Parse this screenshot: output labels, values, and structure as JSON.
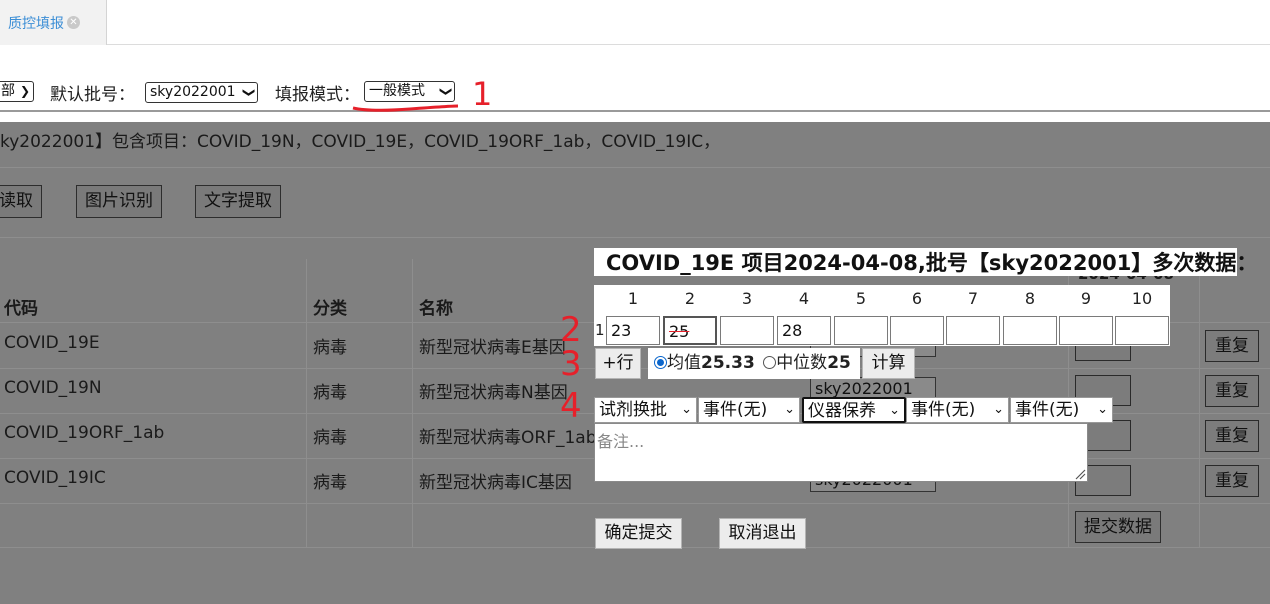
{
  "tabbar": {
    "tab_label": "质控填报",
    "close_glyph": "✕"
  },
  "toprow": {
    "partial_select": "部",
    "batch_label": "默认批号：",
    "batch_value": "sky2022001",
    "mode_label": "填报模式：",
    "mode_value": "一般模式",
    "annotation_1": "1"
  },
  "info_line": "ky2022001】包含项目：COVID_19N，COVID_19E，COVID_19ORF_1ab，COVID_19IC，",
  "action_buttons": {
    "read": "读取",
    "image": "图片识别",
    "text": "文字提取"
  },
  "table": {
    "headers": {
      "code": "代码",
      "category": "分类",
      "name": "名称",
      "date_partial": "2024-04-08"
    },
    "rows": [
      {
        "code": "COVID_19E",
        "category": "病毒",
        "name": "新型冠状病毒E基因",
        "batch": "",
        "redo": "重复"
      },
      {
        "code": "COVID_19N",
        "category": "病毒",
        "name": "新型冠状病毒N基因",
        "batch": "sky2022001",
        "redo": "重复"
      },
      {
        "code": "COVID_19ORF_1ab",
        "category": "病毒",
        "name": "新型冠状病毒ORF_1ab",
        "batch": "",
        "redo": "重复"
      },
      {
        "code": "COVID_19IC",
        "category": "病毒",
        "name": "新型冠状病毒IC基因",
        "batch": "sky2022001",
        "redo": "重复"
      }
    ],
    "submit_data": "提交数据"
  },
  "popup": {
    "title": "COVID_19E 项目2024-04-08,批号【sky2022001】多次数据：",
    "columns": [
      "1",
      "2",
      "3",
      "4",
      "5",
      "6",
      "7",
      "8",
      "9",
      "10"
    ],
    "row_label": "1",
    "values": [
      "23",
      "25",
      "",
      "28",
      "",
      "",
      "",
      "",
      "",
      ""
    ],
    "add_row": "+行",
    "mean_label": "均值",
    "mean_value": "25.33",
    "median_label": "中位数",
    "median_value": "25",
    "calc": "计算",
    "events": [
      "试剂换批",
      "事件(无)",
      "仪器保养",
      "事件(无)",
      "事件(无)"
    ],
    "remark_placeholder": "备注...",
    "confirm": "确定提交",
    "cancel": "取消退出",
    "annotations": [
      "2",
      "3",
      "4"
    ]
  },
  "colors": {
    "annotation": "#e6202a",
    "overlay": "#808080",
    "tab_text": "#3d8fd6"
  }
}
